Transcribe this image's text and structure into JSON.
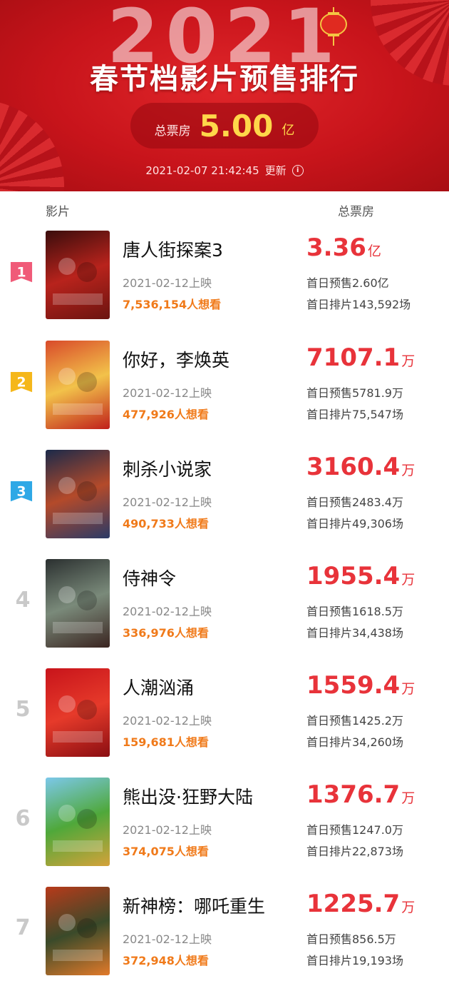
{
  "header": {
    "year": "2021",
    "title": "春节档影片预售排行",
    "total_label": "总票房",
    "total_value": "5.00",
    "total_unit": "亿",
    "updated_time": "2021-02-07 21:42:45",
    "updated_label": "更新"
  },
  "columns": {
    "film": "影片",
    "box_office": "总票房"
  },
  "colors": {
    "accent_red": "#e8333a",
    "want_orange": "#f07a1a",
    "rank1": "#f05a78",
    "rank2": "#f5b71a",
    "rank3": "#2ea8e6"
  },
  "movies": [
    {
      "rank": "1",
      "name": "唐人街探案3",
      "date": "2021-02-12上映",
      "want": "7,536,154人想看",
      "box": "3.36",
      "unit": "亿",
      "presale": "首日预售2.60亿",
      "sessions": "首日排片143,592场",
      "poster_colors": [
        "#3a0d0c",
        "#b8231c",
        "#6b1410"
      ]
    },
    {
      "rank": "2",
      "name": "你好，李焕英",
      "date": "2021-02-12上映",
      "want": "477,926人想看",
      "box": "7107.1",
      "unit": "万",
      "presale": "首日预售5781.9万",
      "sessions": "首日排片75,547场",
      "poster_colors": [
        "#d94a2a",
        "#f2c24a",
        "#c0201b"
      ]
    },
    {
      "rank": "3",
      "name": "刺杀小说家",
      "date": "2021-02-12上映",
      "want": "490,733人想看",
      "box": "3160.4",
      "unit": "万",
      "presale": "首日预售2483.4万",
      "sessions": "首日排片49,306场",
      "poster_colors": [
        "#1b2a4a",
        "#b44a2a",
        "#2a3a66"
      ]
    },
    {
      "rank": "4",
      "name": "侍神令",
      "date": "2021-02-12上映",
      "want": "336,976人想看",
      "box": "1955.4",
      "unit": "万",
      "presale": "首日预售1618.5万",
      "sessions": "首日排片34,438场",
      "poster_colors": [
        "#2b3030",
        "#7a8a7a",
        "#3a2420"
      ]
    },
    {
      "rank": "5",
      "name": "人潮汹涌",
      "date": "2021-02-12上映",
      "want": "159,681人想看",
      "box": "1559.4",
      "unit": "万",
      "presale": "首日预售1425.2万",
      "sessions": "首日排片34,260场",
      "poster_colors": [
        "#c8141b",
        "#e63a2a",
        "#8a0e12"
      ]
    },
    {
      "rank": "6",
      "name": "熊出没·狂野大陆",
      "date": "2021-02-12上映",
      "want": "374,075人想看",
      "box": "1376.7",
      "unit": "万",
      "presale": "首日预售1247.0万",
      "sessions": "首日排片22,873场",
      "poster_colors": [
        "#7cc8ea",
        "#4fa83a",
        "#d4a23a"
      ]
    },
    {
      "rank": "7",
      "name": "新神榜：哪吒重生",
      "date": "2021-02-12上映",
      "want": "372,948人想看",
      "box": "1225.7",
      "unit": "万",
      "presale": "首日预售856.5万",
      "sessions": "首日排片19,193场",
      "poster_colors": [
        "#b83a1a",
        "#3a4a2a",
        "#e27a2a"
      ]
    }
  ]
}
